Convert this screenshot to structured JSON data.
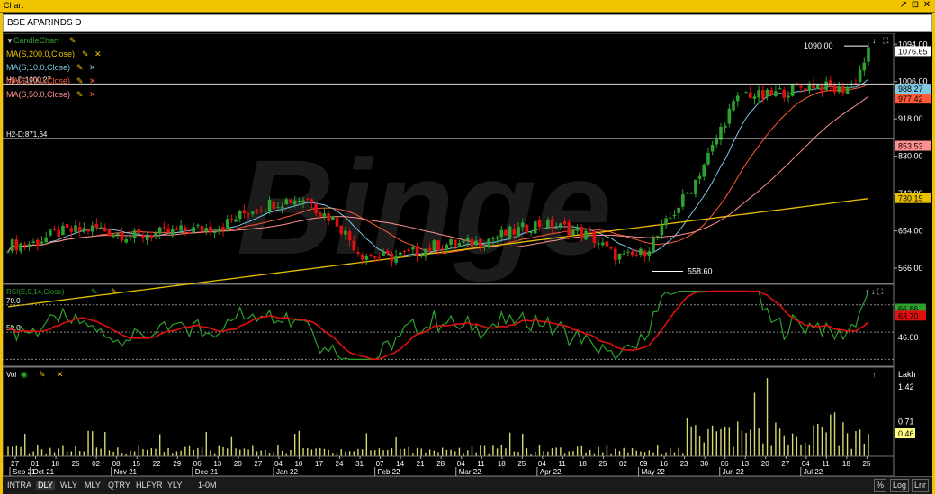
{
  "window": {
    "title": "Chart",
    "controls": [
      "↗",
      "⊡",
      "✕"
    ]
  },
  "symbol": "BSE APARINDS D",
  "main_panel": {
    "legend": [
      {
        "label": "CandleChart",
        "color": "#2ea02e"
      },
      {
        "label": "MA(S,200.0,Close)",
        "color": "#e8c000"
      },
      {
        "label": "MA(S,10.0,Close)",
        "color": "#7ec8e3"
      },
      {
        "label": "MA(S,20.0,Close)",
        "color": "#ff5a36"
      },
      {
        "label": "MA(S,50.0,Close)",
        "color": "#ff9090"
      }
    ],
    "hlines": [
      {
        "label": "H1-D:1000.27",
        "value": 1000.27
      },
      {
        "label": "H2-D:871.64",
        "value": 871.64
      }
    ],
    "annotations": [
      {
        "text": "1090.00",
        "value": 1090.0
      },
      {
        "text": "558.60",
        "value": 558.6
      }
    ],
    "y_ticks": [
      "1094.00",
      "1006.00",
      "918.00",
      "830.00",
      "742.00",
      "654.00",
      "566.00"
    ],
    "price_tags": [
      {
        "text": "1076.65",
        "bg": "#ffffff",
        "fg": "#000000"
      },
      {
        "text": "988.27",
        "bg": "#7ec8e3",
        "fg": "#000000"
      },
      {
        "text": "977.42",
        "bg": "#ff5a36",
        "fg": "#000000"
      },
      {
        "text": "853.53",
        "bg": "#ff9090",
        "fg": "#000000"
      },
      {
        "text": "730.19",
        "bg": "#e8c000",
        "fg": "#000000"
      }
    ],
    "watermark": "Binge"
  },
  "rsi_panel": {
    "legend": "RSI(E,9,14,Close)",
    "levels": [
      "70.0",
      "50.0"
    ],
    "y_ticks": [
      "46.00"
    ],
    "tags": [
      {
        "text": "66.86",
        "bg": "#2ea02e",
        "fg": "#000000"
      },
      {
        "text": "63.70",
        "bg": "#e01010",
        "fg": "#000000"
      }
    ]
  },
  "vol_panel": {
    "legend": "Vol",
    "unit": "Lakh",
    "y_ticks": [
      "1.42",
      "0.71"
    ],
    "tag": {
      "text": "0.46",
      "bg": "#ffff80",
      "fg": "#000000"
    }
  },
  "x_axis": {
    "days": [
      "27",
      "01",
      "18",
      "25",
      "02",
      "08",
      "15",
      "22",
      "29",
      "06",
      "13",
      "20",
      "27",
      "04",
      "10",
      "17",
      "24",
      "31",
      "07",
      "14",
      "21",
      "28",
      "04",
      "11",
      "18",
      "25",
      "04",
      "11",
      "18",
      "25",
      "02",
      "09",
      "16",
      "23",
      "30",
      "06",
      "13",
      "20",
      "27",
      "04",
      "11",
      "18",
      "25"
    ],
    "months": [
      "Sep 21",
      "Oct 21",
      "Nov 21",
      "Dec 21",
      "Jan 22",
      "Feb 22",
      "Mar 22",
      "Apr 22",
      "May 22",
      "Jun 22",
      "Jul 22"
    ]
  },
  "bottom_bar": {
    "timeframes": [
      "INTRA",
      "DLY",
      "WLY",
      "MLY",
      "QTRY",
      "HLFYR",
      "YLY",
      "1-0M"
    ],
    "active": "DLY",
    "right_buttons": [
      "%",
      "Log",
      "Lnr"
    ]
  },
  "chart_data": {
    "type": "candlestick",
    "title": "BSE APARINDS D",
    "ylim": [
      530,
      1120
    ],
    "last_close": 1076.65,
    "high_marker": 1090.0,
    "low_marker": 558.6,
    "ma": {
      "ma10": 988.27,
      "ma20": 977.42,
      "ma50": 853.53,
      "ma200": 730.19
    },
    "rsi": {
      "value": 66.86,
      "signal": 63.7,
      "levels": [
        70,
        50
      ]
    },
    "volume": {
      "last": 0.46,
      "max_label": 1.42,
      "unit": "Lakh"
    }
  },
  "colors": {
    "bull": "#2ea02e",
    "bear": "#e01010",
    "ma200": "#e8c000",
    "ma10": "#7ec8e3",
    "ma20": "#ff5a36",
    "ma50": "#ff9090",
    "rsi": "#2ea02e",
    "rsi_signal": "#e01010",
    "volume": "#d8d870",
    "frame": "#f2c400"
  }
}
